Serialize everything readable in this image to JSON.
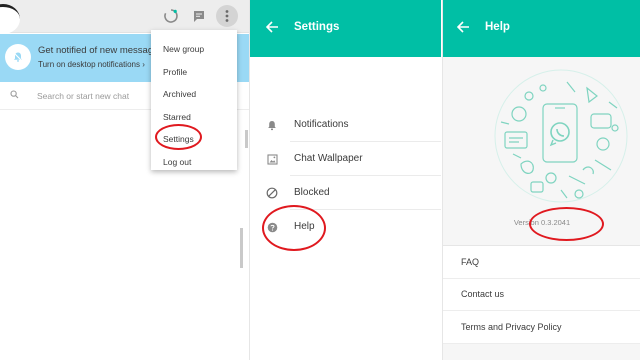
{
  "chat_panel": {
    "header_icons": [
      "status-icon",
      "new-chat-icon",
      "menu-icon"
    ],
    "notification": {
      "title": "Get notified of new messages",
      "link": "Turn on desktop notifications ›",
      "icon": "bell-off-icon"
    },
    "search": {
      "placeholder": "Search or start new chat",
      "icon": "search-icon"
    },
    "menu": {
      "items": [
        "New group",
        "Profile",
        "Archived",
        "Starred",
        "Settings",
        "Log out"
      ]
    }
  },
  "settings_panel": {
    "title": "Settings",
    "items": [
      {
        "label": "Notifications",
        "icon": "bell-icon"
      },
      {
        "label": "Chat Wallpaper",
        "icon": "wallpaper-icon"
      },
      {
        "label": "Blocked",
        "icon": "blocked-icon"
      },
      {
        "label": "Help",
        "icon": "help-icon"
      }
    ]
  },
  "help_panel": {
    "title": "Help",
    "version": "Version 0.3.2041",
    "links": [
      "FAQ",
      "Contact us",
      "Terms and Privacy Policy"
    ]
  },
  "colors": {
    "teal_header": "#00bfa5",
    "notify_banner": "#9ad9f5",
    "highlight_ring": "#e0191f",
    "doodle": "#7fd4c0"
  }
}
